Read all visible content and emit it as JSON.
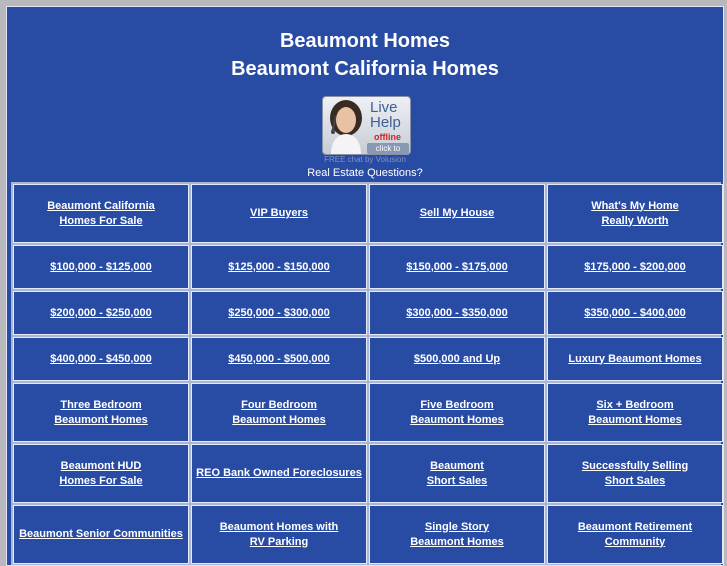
{
  "header": {
    "title_line1": "Beaumont Homes",
    "title_line2": "Beaumont California Homes"
  },
  "live_help": {
    "line1": "Live",
    "line2": "Help",
    "status": "offline",
    "action": "click to email",
    "credit": "FREE chat by Volusion",
    "icon": "agent-avatar-icon"
  },
  "questions_text": "Real Estate Questions?",
  "links": {
    "r1": [
      "Beaumont California\nHomes For Sale",
      "VIP Buyers",
      "Sell My House",
      "What's My Home\nReally Worth"
    ],
    "r2": [
      "$100,000 - $125,000",
      "$125,000 - $150,000",
      "$150,000 - $175,000",
      "$175,000 - $200,000"
    ],
    "r3": [
      "$200,000 - $250,000",
      "$250,000 - $300,000",
      "$300,000 - $350,000",
      "$350,000 - $400,000"
    ],
    "r4": [
      "$400,000 - $450,000",
      "$450,000 - $500,000",
      "$500,000 and Up",
      "Luxury Beaumont Homes"
    ],
    "r5": [
      "Three Bedroom\nBeaumont Homes",
      "Four Bedroom\nBeaumont Homes",
      "Five Bedroom\nBeaumont Homes",
      "Six + Bedroom\nBeaumont Homes"
    ],
    "r6": [
      "Beaumont HUD\nHomes For Sale",
      "REO Bank Owned Foreclosures",
      "Beaumont\nShort Sales",
      "Successfully Selling\nShort Sales"
    ],
    "r7": [
      "Beaumont Senior Communities",
      "Beaumont Homes with\nRV Parking",
      "Single Story\nBeaumont Homes",
      "Beaumont Retirement\nCommunity"
    ]
  }
}
